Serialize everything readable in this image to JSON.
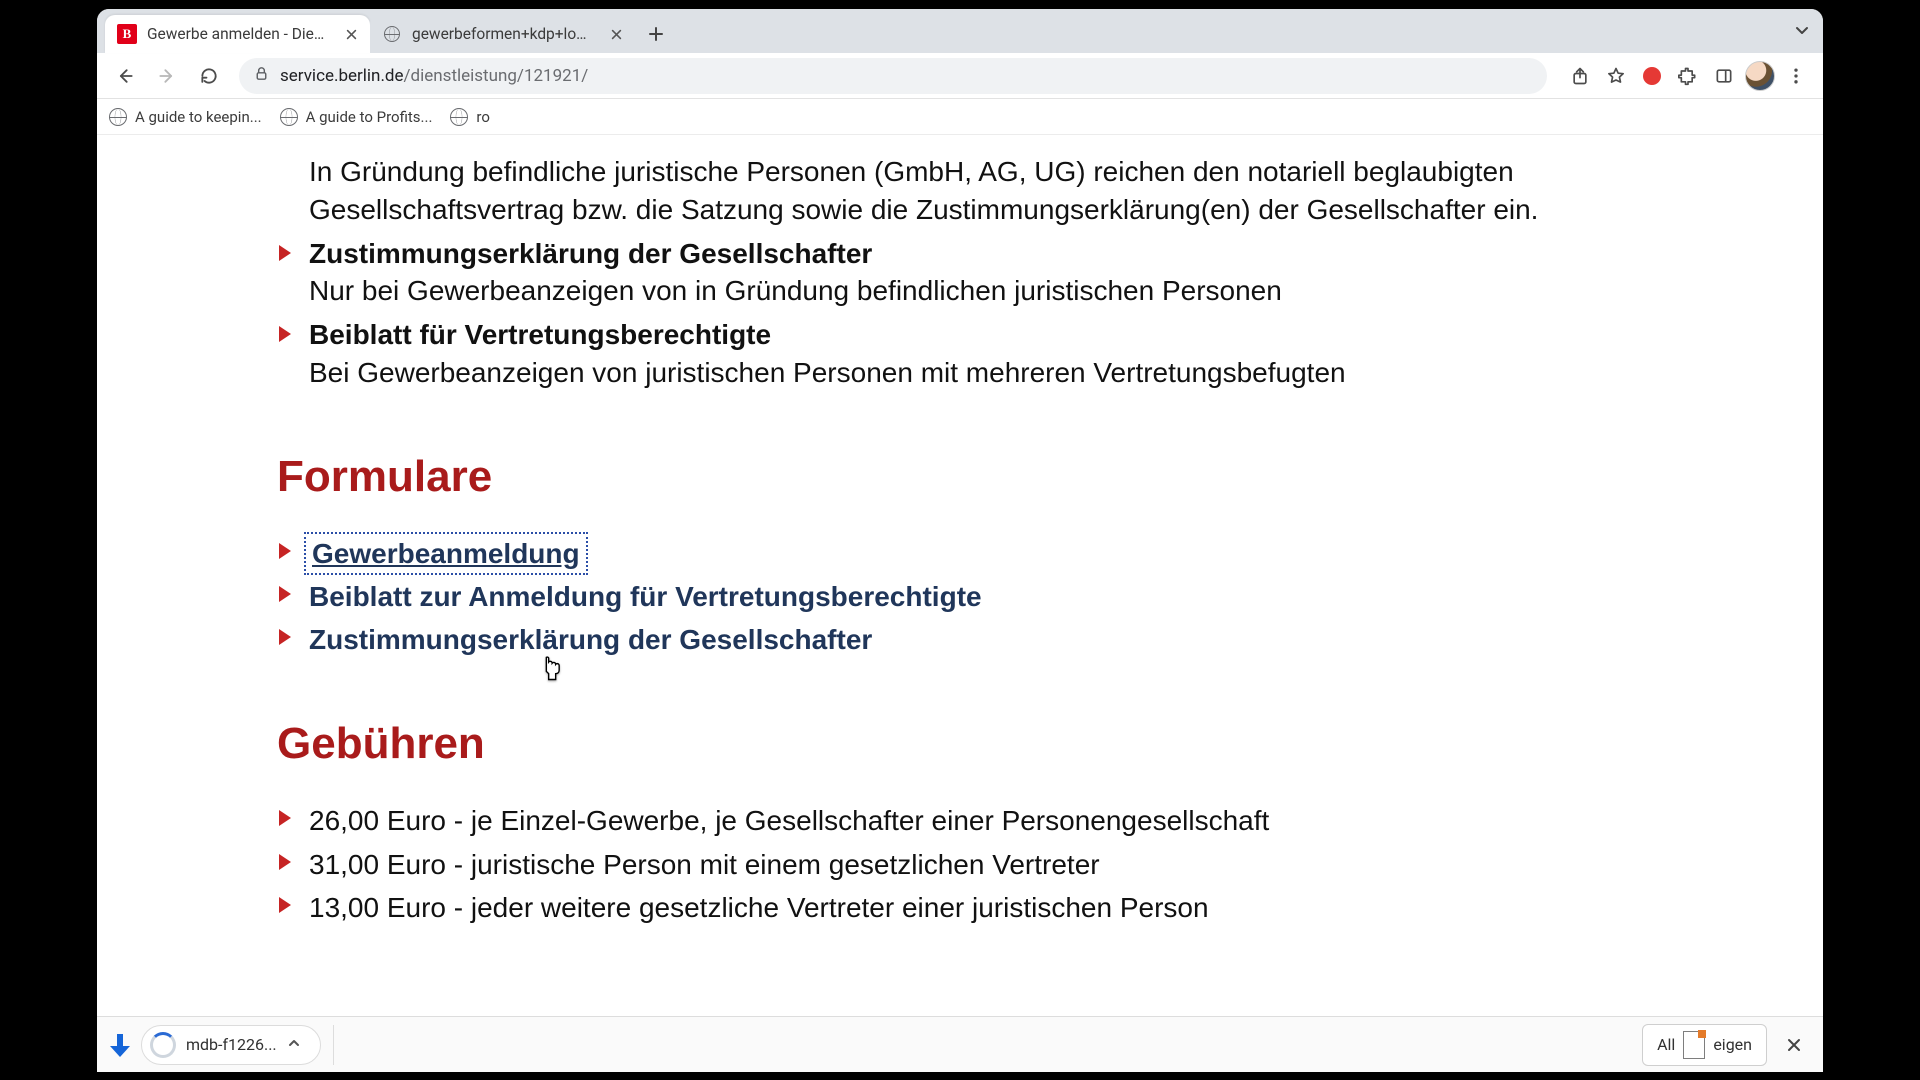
{
  "tabs": [
    {
      "title": "Gewerbe anmelden - Dienstle",
      "kind": "berlin"
    },
    {
      "title": "gewerbeformen+kdp+low+con",
      "kind": "globe"
    }
  ],
  "omnibox": {
    "host": "service.berlin.de",
    "path": "/dienstleistung/121921/"
  },
  "bookmarks": [
    {
      "label": "A guide to keepin..."
    },
    {
      "label": "A guide to Profits..."
    },
    {
      "label": "ro"
    }
  ],
  "intro": [
    {
      "desc_only": "In Gründung befindliche juristische Personen (GmbH, AG, UG) reichen den notariell beglaubigten Gesellschaftsvertrag bzw. die Satzung sowie die Zustimmungserklärung(en) der Gesellschafter ein."
    },
    {
      "title": "Zustimmungserklärung der Gesellschafter",
      "desc": "Nur bei Gewerbeanzeigen von in Gründung befindlichen juristischen Personen"
    },
    {
      "title": "Beiblatt für Vertretungsberechtigte",
      "desc": "Bei Gewerbeanzeigen von juristischen Personen mit mehreren Vertretungsbefugten"
    }
  ],
  "forms_heading": "Formulare",
  "forms": [
    {
      "label": "Gewerbeanmeldung",
      "focused": true
    },
    {
      "label": "Beiblatt zur Anmeldung für Vertretungsberechtigte"
    },
    {
      "label": "Zustimmungserklärung der Gesellschafter"
    }
  ],
  "fees_heading": "Gebühren",
  "fees": [
    "26,00 Euro - je Einzel-Gewerbe, je Gesellschafter einer Personengesellschaft",
    "31,00 Euro - juristische Person mit einem gesetzlichen Vertreter",
    "13,00 Euro - jeder weitere gesetzliche Vertreter einer juristischen Person"
  ],
  "download": {
    "filename": "mdb-f1226...",
    "show_all_pre": "All",
    "show_all_post": "eigen"
  }
}
